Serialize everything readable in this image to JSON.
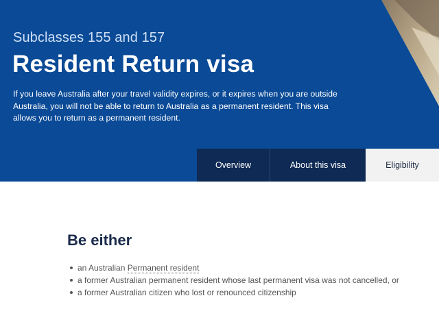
{
  "hero": {
    "subtitle": "Subclasses 155 and 157",
    "title": "Resident Return visa",
    "intro": "If you leave Australia after your travel validity expires, or it expires when you are outside Australia, you will not be able to return to Australia as a permanent resident. This visa allows you to return as a permanent resident.",
    "background_color": "#0a4a96"
  },
  "tabs": [
    {
      "label": "Overview",
      "active": false
    },
    {
      "label": "About this visa",
      "active": false
    },
    {
      "label": "Eligibility",
      "active": true
    }
  ],
  "eligibility": {
    "heading": "Be either",
    "items": [
      {
        "prefix": "an Australian ",
        "link": "Permanent resident"
      },
      {
        "text": "a former Australian permanent resident whose last permanent visa was not cancelled, or"
      },
      {
        "text": "a former Australian citizen who lost or renounced citizenship"
      }
    ]
  }
}
